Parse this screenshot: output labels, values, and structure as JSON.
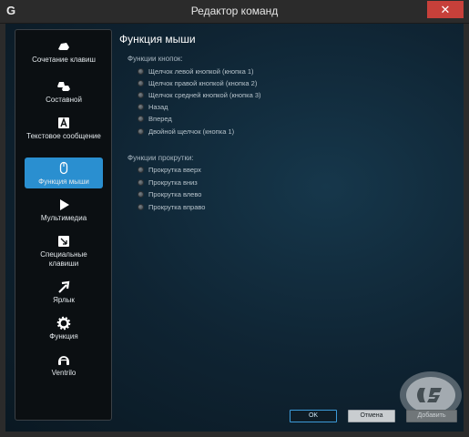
{
  "window": {
    "title": "Редактор команд",
    "app_icon_letter": "G",
    "close_symbol": "✕"
  },
  "sidebar": {
    "items": [
      {
        "label": "Сочетание клавиш",
        "icon": "keystroke-icon",
        "active": false
      },
      {
        "label": "Составной",
        "icon": "multikey-icon",
        "active": false
      },
      {
        "label": "Текстовое сообщение",
        "icon": "text-block-icon",
        "active": false
      },
      {
        "label": "Функция мыши",
        "icon": "mouse-icon",
        "active": true
      },
      {
        "label": "Мультимедиа",
        "icon": "media-play-icon",
        "active": false
      },
      {
        "label": "Специальные клавиши",
        "icon": "hotkey-icon",
        "active": false
      },
      {
        "label": "Ярлык",
        "icon": "shortcut-arrow-icon",
        "active": false
      },
      {
        "label": "Функция",
        "icon": "gear-icon",
        "active": false
      },
      {
        "label": "Ventrilo",
        "icon": "headset-icon",
        "active": false
      }
    ]
  },
  "main": {
    "title": "Функция мыши",
    "button_functions": {
      "label": "Функции кнопок:",
      "options": [
        "Щелчок левой кнопкой (кнопка 1)",
        "Щелчок правой кнопкой (кнопка 2)",
        "Щелчок средней кнопкой (кнопка 3)",
        "Назад",
        "Вперед",
        "Двойной щелчок (кнопка 1)"
      ]
    },
    "scroll_functions": {
      "label": "Функции прокрутки:",
      "options": [
        "Прокрутка вверх",
        "Прокрутка вниз",
        "Прокрутка влево",
        "Прокрутка вправо"
      ]
    }
  },
  "footer": {
    "ok_label": "OK",
    "cancel_label": "Отмена",
    "add_label": "Добавить"
  },
  "colors": {
    "accent": "#2a8fd0",
    "titlebar": "#2b2b2b",
    "close": "#c7403a",
    "background": "#0f2433"
  }
}
